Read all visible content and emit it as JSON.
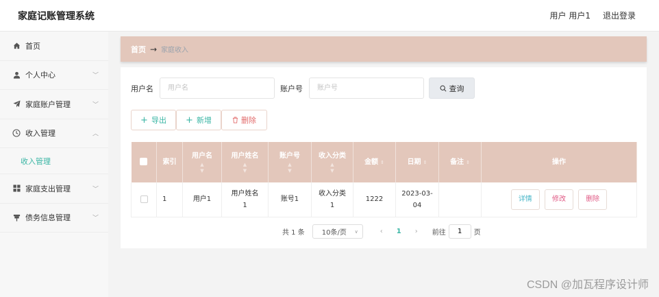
{
  "header": {
    "title": "家庭记账管理系统",
    "user_label": "用户 用户1",
    "logout_label": "退出登录"
  },
  "sidebar": {
    "items": [
      {
        "label": "首页",
        "icon": "home-icon",
        "arrow": ""
      },
      {
        "label": "个人中心",
        "icon": "user-icon",
        "arrow": "﹀"
      },
      {
        "label": "家庭账户管理",
        "icon": "send-icon",
        "arrow": "﹀"
      },
      {
        "label": "收入管理",
        "icon": "clock-icon",
        "arrow": "︿"
      },
      {
        "label": "家庭支出管理",
        "icon": "grid-icon",
        "arrow": "﹀"
      },
      {
        "label": "债务信息管理",
        "icon": "pin-icon",
        "arrow": "﹀"
      }
    ],
    "submenu": {
      "label": "收入管理"
    }
  },
  "breadcrumb": {
    "home": "首页",
    "separator": "→",
    "current": "家庭收入"
  },
  "search": {
    "username_label": "用户名",
    "username_placeholder": "用户名",
    "username_value": "",
    "account_label": "账户号",
    "account_placeholder": "账户号",
    "account_value": "",
    "query_label": "查询"
  },
  "actions": {
    "export": "导出",
    "add": "新增",
    "delete": "删除"
  },
  "table": {
    "headers": {
      "index": "索引",
      "username": "用户名",
      "realname": "用户姓名",
      "account": "账户号",
      "category": "收入分类",
      "amount": "金额",
      "date": "日期",
      "remark": "备注",
      "ops": "操作"
    },
    "rows": [
      {
        "index": "1",
        "username": "用户1",
        "realname_l1": "用户姓名",
        "realname_l2": "1",
        "account": "账号1",
        "category_l1": "收入分类",
        "category_l2": "1",
        "amount": "1222",
        "date_l1": "2023-03-",
        "date_l2": "04",
        "remark": "",
        "detail": "详情",
        "edit": "修改",
        "delete": "删除"
      }
    ]
  },
  "pagination": {
    "total": "共 1 条",
    "page_size": "10条/页",
    "current_page": "1",
    "goto_label": "前往",
    "goto_value": "1",
    "page_suffix": "页"
  },
  "watermark": "CSDN @加瓦程序设计师",
  "colors": {
    "accent": "#3bb6a5",
    "header_bg": "#e3c7bb",
    "danger": "#e05a85"
  }
}
